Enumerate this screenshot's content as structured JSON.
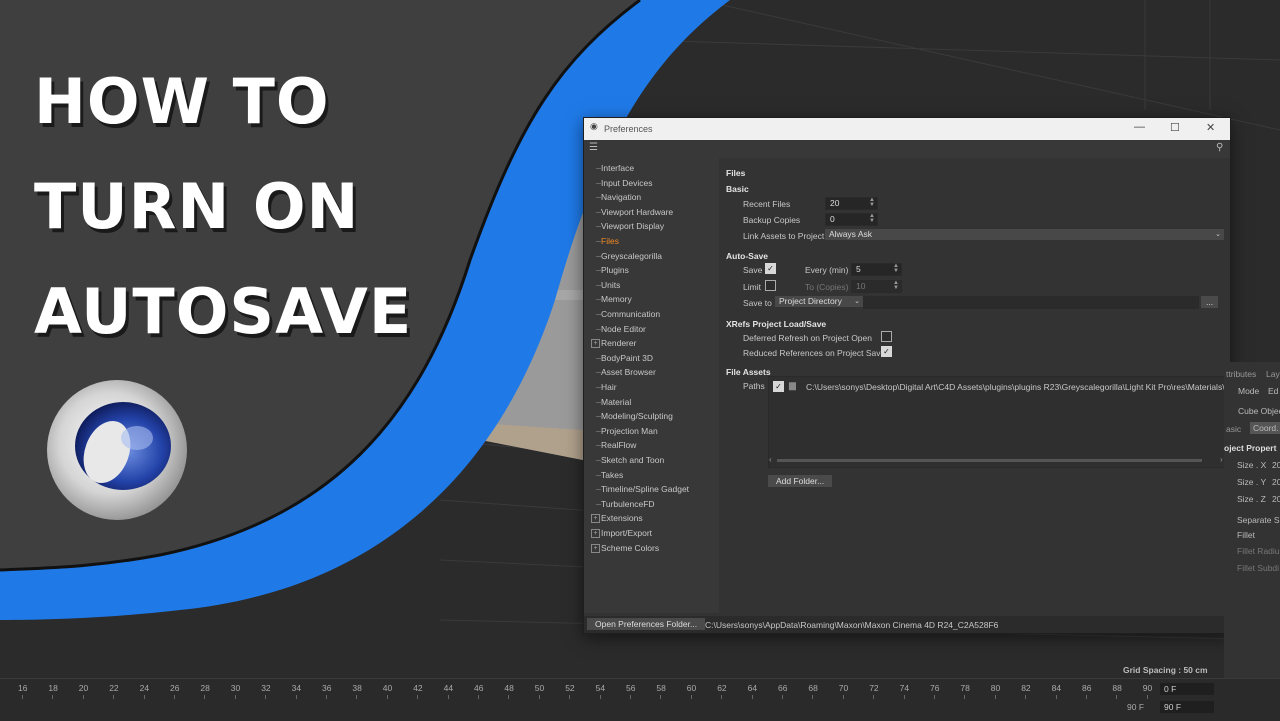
{
  "thumbnail": {
    "title_lines": [
      "HOW TO",
      "TURN ON",
      "AUTOSAVE"
    ],
    "accent_color": "#1f7ae8"
  },
  "logo": {
    "name": "cinema-4d-logo"
  },
  "window": {
    "title": "Preferences",
    "controls": {
      "minimize": "—",
      "maximize": "☐",
      "close": "✕"
    }
  },
  "tree": {
    "items": [
      {
        "label": "Interface",
        "expandable": false
      },
      {
        "label": "Input Devices",
        "expandable": false
      },
      {
        "label": "Navigation",
        "expandable": false
      },
      {
        "label": "Viewport Hardware",
        "expandable": false
      },
      {
        "label": "Viewport Display",
        "expandable": false
      },
      {
        "label": "Files",
        "expandable": false,
        "active": true
      },
      {
        "label": "Greyscalegorilla",
        "expandable": false
      },
      {
        "label": "Plugins",
        "expandable": false
      },
      {
        "label": "Units",
        "expandable": false
      },
      {
        "label": "Memory",
        "expandable": false
      },
      {
        "label": "Communication",
        "expandable": false
      },
      {
        "label": "Node Editor",
        "expandable": false
      },
      {
        "label": "Renderer",
        "expandable": true
      },
      {
        "label": "BodyPaint 3D",
        "expandable": false
      },
      {
        "label": "Asset Browser",
        "expandable": false
      },
      {
        "label": "Hair",
        "expandable": false
      },
      {
        "label": "Material",
        "expandable": false
      },
      {
        "label": "Modeling/Sculpting",
        "expandable": false
      },
      {
        "label": "Projection Man",
        "expandable": false
      },
      {
        "label": "RealFlow",
        "expandable": false
      },
      {
        "label": "Sketch and Toon",
        "expandable": false
      },
      {
        "label": "Takes",
        "expandable": false
      },
      {
        "label": "Timeline/Spline Gadget",
        "expandable": false
      },
      {
        "label": "TurbulenceFD",
        "expandable": false
      },
      {
        "label": "Extensions",
        "expandable": true
      },
      {
        "label": "Import/Export",
        "expandable": true
      },
      {
        "label": "Scheme Colors",
        "expandable": true
      }
    ]
  },
  "files": {
    "heading": "Files",
    "basic": {
      "heading": "Basic",
      "recent_files_label": "Recent Files",
      "recent_files_value": "20",
      "backup_copies_label": "Backup Copies",
      "backup_copies_value": "0",
      "link_assets_label": "Link Assets to Project",
      "link_assets_value": "Always Ask"
    },
    "autosave": {
      "heading": "Auto-Save",
      "save_label": "Save",
      "save_checked": true,
      "every_label": "Every (min)",
      "every_value": "5",
      "limit_label": "Limit",
      "limit_checked": false,
      "copies_label": "To (Copies)",
      "copies_value": "10",
      "save_to_label": "Save to",
      "save_to_value": "Project Directory",
      "browse_label": "..."
    },
    "xrefs": {
      "heading": "XRefs Project Load/Save",
      "deferred_label": "Deferred Refresh on Project Open",
      "deferred_checked": false,
      "reduced_label": "Reduced References on Project Save",
      "reduced_checked": true
    },
    "file_assets": {
      "heading": "File Assets",
      "paths_label": "Paths",
      "path_value": "C:\\Users\\sonys\\Desktop\\Digital Art\\C4D Assets\\plugins\\plugins R23\\Greyscalegorilla\\Light Kit Pro\\res\\Materials\\te",
      "path_checked": true,
      "add_folder_label": "Add Folder..."
    }
  },
  "statusbar": {
    "open_folder_label": "Open Preferences Folder...",
    "path": "C:\\Users\\sonys\\AppData\\Roaming\\Maxon\\Maxon Cinema 4D R24_C2A528F6"
  },
  "attributes_panel": {
    "tab_label": "ttributes",
    "tab2_label": "Lay",
    "mode_label": "Mode",
    "edit_label": "Ed",
    "object_label": "Cube Objec",
    "basic_tab": "asic",
    "coord_tab": "Coord.",
    "props_heading": "oject Propert",
    "size_x": "Size . X",
    "size_y": "Size . Y",
    "size_z": "Size . Z",
    "size_val": "20",
    "separate": "Separate Su",
    "fillet": "Fillet",
    "fillet_radius": "Fillet Radiu",
    "fillet_subd": "Fillet Subdi"
  },
  "viewport": {
    "grid_spacing": "Grid Spacing : 50 cm"
  },
  "timeline": {
    "ticks": [
      "16",
      "18",
      "20",
      "22",
      "24",
      "26",
      "28",
      "30",
      "32",
      "34",
      "36",
      "38",
      "40",
      "42",
      "44",
      "46",
      "48",
      "50",
      "52",
      "54",
      "56",
      "58",
      "60",
      "62",
      "64",
      "66",
      "68",
      "70",
      "72",
      "74",
      "76",
      "78",
      "80",
      "82",
      "84",
      "86",
      "88",
      "90"
    ],
    "current_frame": "0 F",
    "end_frame": "90 F",
    "end_frame_2": "90 F",
    "end_frame_3": "90 F"
  }
}
